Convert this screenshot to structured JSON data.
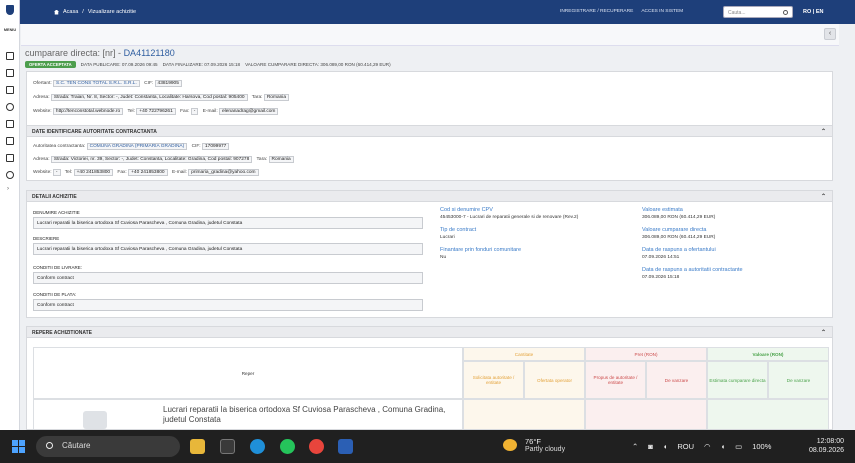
{
  "topbar": {
    "breadcrumb_home": "Acasa",
    "breadcrumb_sep": "/",
    "breadcrumb_page": "Vizualizare achizitie",
    "register_link": "INREGISTRARE / RECUPERARE",
    "login_link": "ACCES IN SISTEM",
    "search_placeholder": "Cauta...",
    "lang": "RO | EN",
    "menu_label": "MENIU"
  },
  "header": {
    "prefix": "cumparare directa: [nr] -",
    "code": "DA41121180",
    "badge": "OFERTA ACCEPTATA",
    "published": "DATA PUBLICARE: 07.09.2026 09:45",
    "finalized": "DATA FINALIZARE: 07.09.2026 15:18",
    "value": "VALOARE CUMPARARE DIRECTA: 306.089,00 RON (60.414,29 EUR)"
  },
  "supplier": {
    "ofertant_label": "Ofertant:",
    "ofertant": "S.C. TEN CONS TOTAL S.R.L. S.R.L.",
    "cif_label": "CIF:",
    "cif": "43819905",
    "adresa_label": "Adresa:",
    "adresa": "Strada: Traian, Nr. 8, Sector: -, Judet: Constanta, Localitate: Harsova, Cod postal: 905400",
    "tara_label": "Tara:",
    "tara": "Romania",
    "website_label": "Website:",
    "website": "http://tenconstotal.webnode.ro",
    "tel_label": "Tel:",
    "tel": "+40 722796261",
    "fax_label": "Fax:",
    "fax": "-",
    "email_label": "E-mail:",
    "email": "elenanadrag@gmail.com"
  },
  "authority": {
    "title": "DATE IDENTIFICARE AUTORITATE CONTRACTANTA",
    "ac_label": "Autoritatea contractanta:",
    "ac": "COMUNA GRADINA (PRIMARIA GRADINA)",
    "cif_label": "CIF:",
    "cif": "17099977",
    "adresa_label": "Adresa:",
    "adresa": "Strada: Victoriei, nr. 39, Sector: -, Judet: Constanta, Localitate: Gradina, Cod postal: 907278",
    "tara_label": "Tara:",
    "tara": "Romania",
    "website_label": "Website:",
    "website": "-",
    "tel_label": "Tel:",
    "tel": "+40 241853800",
    "fax_label": "Fax:",
    "fax": "+40 241853800",
    "email_label": "E-mail:",
    "email": "primaria_gradina@yahoo.com"
  },
  "details": {
    "title": "DETALII ACHIZITIE",
    "denumire_label": "DENUMIRE ACHIZITIE",
    "denumire": "Lucrari reparatii la biserica ortodoxa Sf Cuviosa Parascheva , Comuna Gradina, judetul Constata",
    "descriere_label": "DESCRIERE",
    "descriere": "Lucrari reparatii la biserica ortodoxa Sf Cuviosa Parascheva , Comuna Gradina, judetul Constata",
    "livrare_label": "CONDITII DE LIVRARE:",
    "livrare": "Conform contract",
    "plata_label": "CONDITII DE PLATA:",
    "plata": "Conform contract",
    "cpv_label": "Cod si denumire CPV",
    "cpv": "45453000-7 - Lucrari de reparatii generale si de renovare (Rev.2)",
    "tip_label": "Tip de contract",
    "tip": "Lucrari",
    "fonduri_label": "Finantare prin fonduri comunitare",
    "fonduri": "Nu",
    "val_est_label": "Valoare estimata",
    "val_est": "306.089,00 RON (60.414,29 EUR)",
    "val_cd_label": "Valoare cumparare directa",
    "val_cd": "306.089,00 RON (60.414,29 EUR)",
    "raspuns_of_label": "Data de raspuns a ofertantului",
    "raspuns_of": "07.09.2026 14:51",
    "raspuns_ac_label": "Data de raspuns a autoritatii contractante",
    "raspuns_ac": "07.09.2026 15:18"
  },
  "items": {
    "title": "REPERE ACHIZITIONATE",
    "col_reper": "Reper",
    "grp_cantitate": "Cantitate",
    "grp_pret": "Pret (RON)",
    "grp_valoare": "Valoare (RON)",
    "col_solicitata": "Solicitata autoritate / entitate",
    "col_oferta": "Ofertata operator",
    "col_propus": "Propus de autoritate / entitate",
    "col_vanzare1": "De vanzare",
    "col_estimata": "Estimata cumparare directa",
    "col_vanzare2": "De vanzare",
    "product_name": "Lucrari reparatii la biserica ortodoxa Sf Cuviosa Parascheva , Comuna Gradina, judetul Constata"
  },
  "taskbar": {
    "search": "Căutare",
    "temp": "76°F",
    "condition": "Partly cloudy",
    "lang": "ROU",
    "battery": "100%",
    "time": "12:08:00",
    "date": "08.09.2026"
  },
  "colors": {
    "topbar": "#1e3f7a",
    "badge": "#4d9e4d",
    "link": "#2f5ea0",
    "cantitate": "#e3a23a",
    "pret": "#cc4b4b",
    "valoare": "#4aa24a"
  }
}
